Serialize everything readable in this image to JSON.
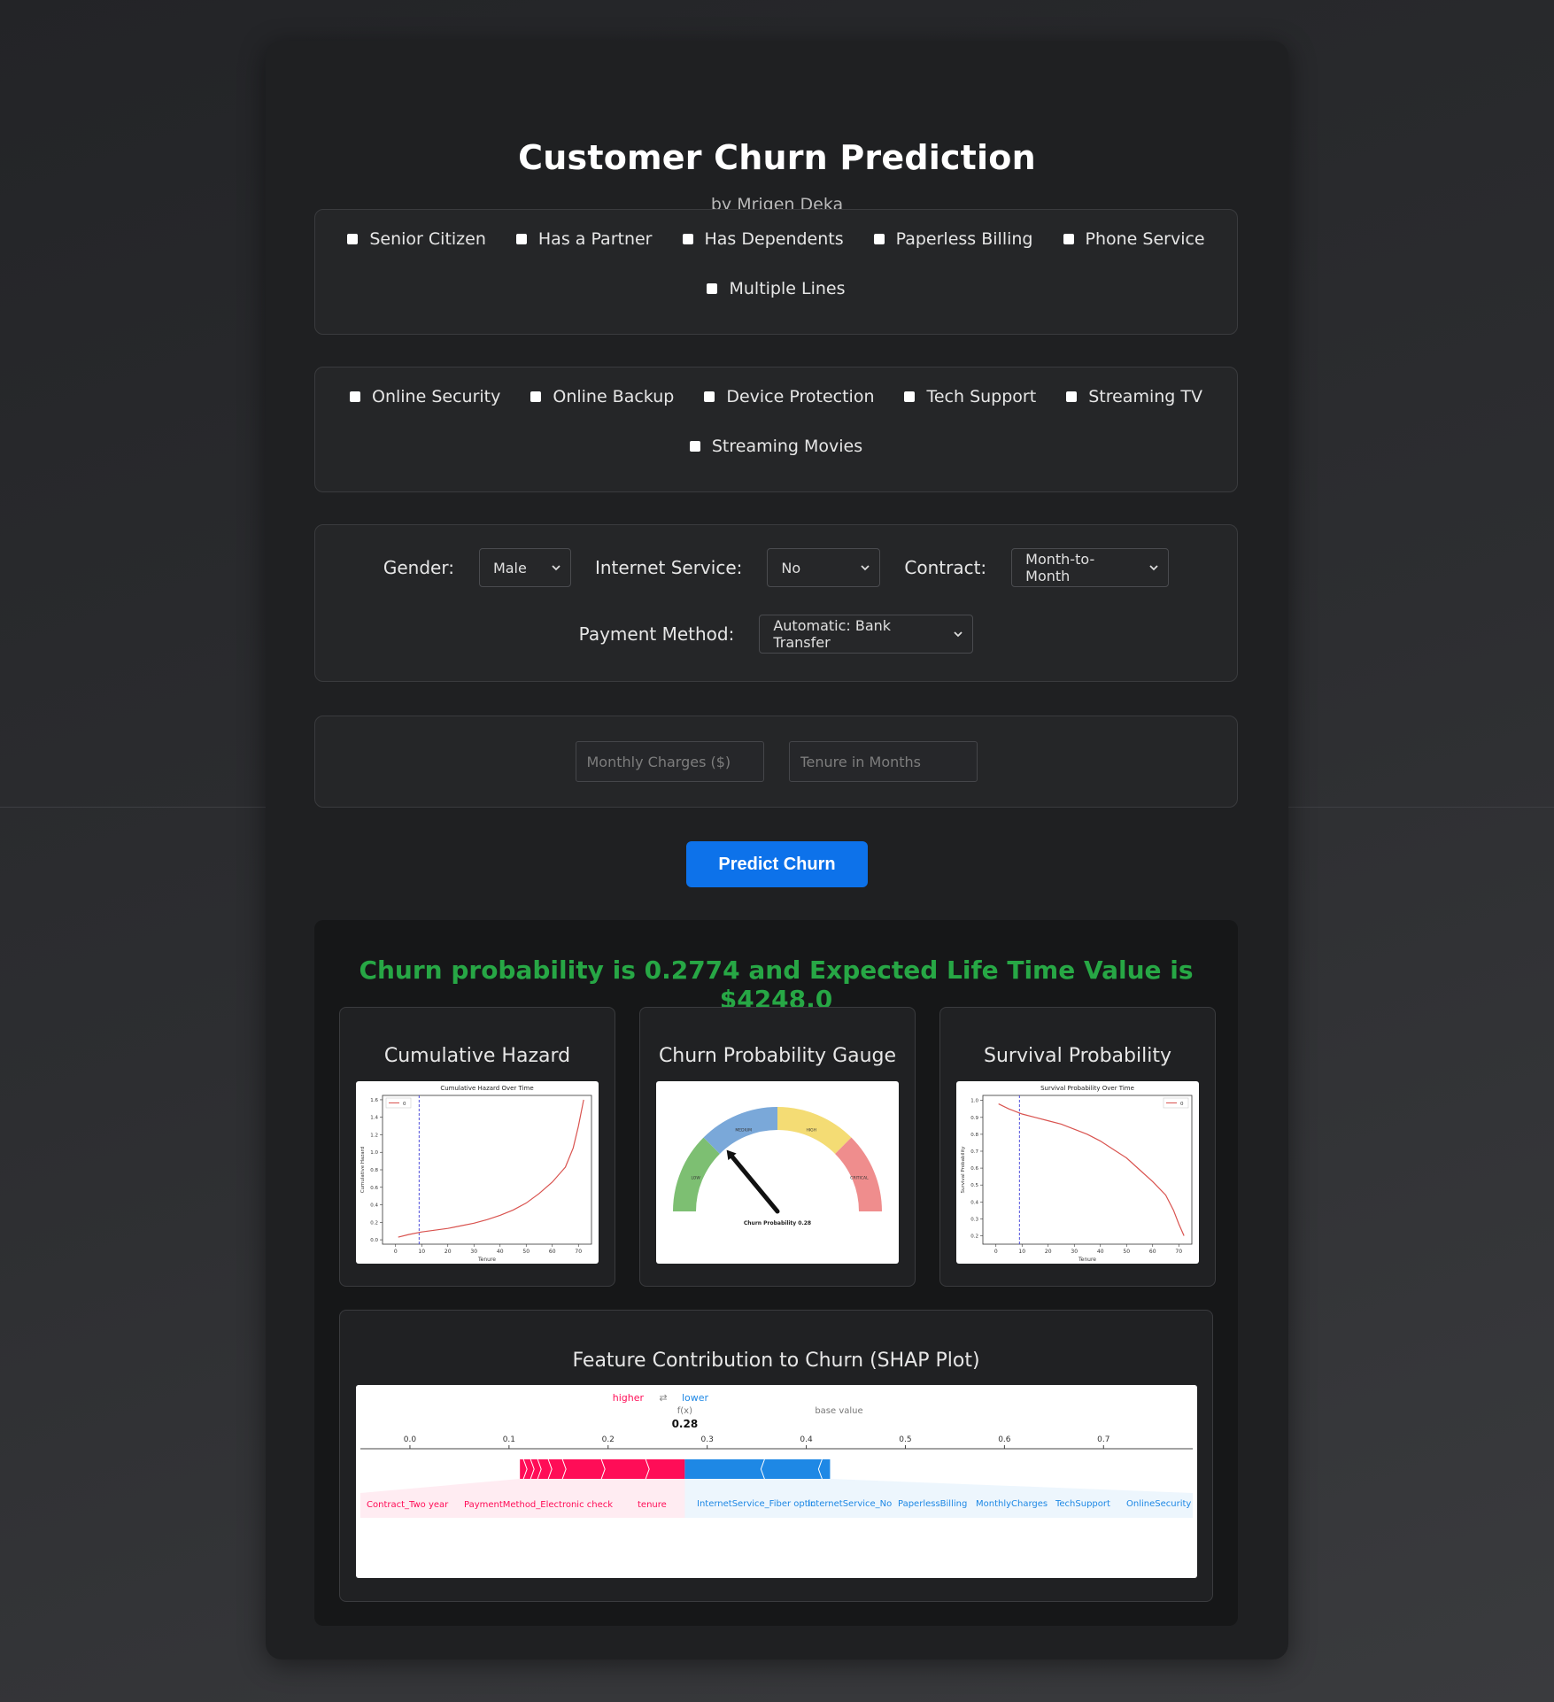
{
  "header": {
    "title": "Customer Churn Prediction",
    "subtitle": "by Mrigen Deka"
  },
  "checkbox_groups": [
    [
      "Senior Citizen",
      "Has a Partner",
      "Has Dependents",
      "Paperless Billing",
      "Phone Service",
      "Multiple Lines"
    ],
    [
      "Online Security",
      "Online Backup",
      "Device Protection",
      "Tech Support",
      "Streaming TV",
      "Streaming Movies"
    ]
  ],
  "selects": {
    "gender": {
      "label": "Gender:",
      "value": "Male"
    },
    "internet": {
      "label": "Internet Service:",
      "value": "No"
    },
    "contract": {
      "label": "Contract:",
      "value": "Month-to-Month"
    },
    "payment": {
      "label": "Payment Method:",
      "value": "Automatic: Bank Transfer"
    }
  },
  "inputs": {
    "monthly": {
      "placeholder": "Monthly Charges ($)",
      "value": ""
    },
    "tenure": {
      "placeholder": "Tenure in Months",
      "value": ""
    }
  },
  "predict_button": "Predict Churn",
  "result": {
    "text": "Churn probability is 0.2774 and Expected Life Time Value is $4248.0",
    "color": "#27a745"
  },
  "charts": {
    "hazard_card_title": "Cumulative Hazard",
    "gauge_card_title": "Churn Probability Gauge",
    "survival_card_title": "Survival Probability",
    "shap_card_title": "Feature Contribution to Churn (SHAP Plot)"
  },
  "chart_data": [
    {
      "type": "line",
      "title": "Cumulative Hazard Over Time",
      "xlabel": "Tenure",
      "ylabel": "Cumulative Hazard",
      "legend": [
        "0"
      ],
      "xlim": [
        -5,
        75
      ],
      "ylim": [
        -0.05,
        1.65
      ],
      "xticks": [
        0,
        10,
        20,
        30,
        40,
        50,
        60,
        70
      ],
      "yticks": [
        0.0,
        0.2,
        0.4,
        0.6,
        0.8,
        1.0,
        1.2,
        1.4,
        1.6
      ],
      "vline_x": 9,
      "x": [
        1,
        5,
        10,
        15,
        20,
        25,
        30,
        35,
        40,
        45,
        50,
        55,
        60,
        65,
        68,
        70,
        72
      ],
      "y": [
        0.03,
        0.06,
        0.09,
        0.11,
        0.13,
        0.16,
        0.19,
        0.23,
        0.28,
        0.34,
        0.42,
        0.53,
        0.66,
        0.83,
        1.05,
        1.3,
        1.6
      ]
    },
    {
      "type": "gauge",
      "title": "Churn Probability 0.28",
      "value": 0.28,
      "bands": [
        {
          "label": "LOW",
          "range": [
            0,
            0.25
          ],
          "color": "#7dbf72"
        },
        {
          "label": "MEDIUM",
          "range": [
            0.25,
            0.5
          ],
          "color": "#7aa8d9"
        },
        {
          "label": "HIGH",
          "range": [
            0.5,
            0.75
          ],
          "color": "#f4dc74"
        },
        {
          "label": "CRITICAL",
          "range": [
            0.75,
            1.0
          ],
          "color": "#ef8d8d"
        }
      ]
    },
    {
      "type": "line",
      "title": "Survival Probability Over Time",
      "xlabel": "Tenure",
      "ylabel": "Survival Probability",
      "legend": [
        "0"
      ],
      "xlim": [
        -5,
        75
      ],
      "ylim": [
        0.15,
        1.03
      ],
      "xticks": [
        0,
        10,
        20,
        30,
        40,
        50,
        60,
        70
      ],
      "yticks": [
        0.2,
        0.3,
        0.4,
        0.5,
        0.6,
        0.7,
        0.8,
        0.9,
        1.0
      ],
      "vline_x": 9,
      "x": [
        1,
        5,
        10,
        15,
        20,
        25,
        30,
        35,
        40,
        45,
        50,
        55,
        60,
        65,
        68,
        70,
        72
      ],
      "y": [
        0.98,
        0.95,
        0.92,
        0.9,
        0.88,
        0.86,
        0.83,
        0.8,
        0.76,
        0.71,
        0.66,
        0.59,
        0.52,
        0.44,
        0.35,
        0.27,
        0.2
      ]
    },
    {
      "type": "shap_force",
      "fx_label": "f(x)",
      "fx_value": "0.28",
      "base_value_label": "base value",
      "higher_label": "higher",
      "lower_label": "lower",
      "xlim": [
        -0.05,
        0.79
      ],
      "xticks": [
        0.0,
        0.1,
        0.2,
        0.3,
        0.4,
        0.5,
        0.6,
        0.7
      ],
      "output": 0.2774,
      "base_value": 0.433,
      "colors": {
        "higher": "#ff0d57",
        "lower": "#1e88e5"
      },
      "positive_features": [
        "Contract_Two year",
        "PaymentMethod_Electronic check",
        "tenure"
      ],
      "negative_features": [
        "InternetService_Fiber optic",
        "InternetService_No",
        "PaperlessBilling",
        "MonthlyCharges",
        "TechSupport",
        "OnlineSecurity"
      ]
    }
  ]
}
